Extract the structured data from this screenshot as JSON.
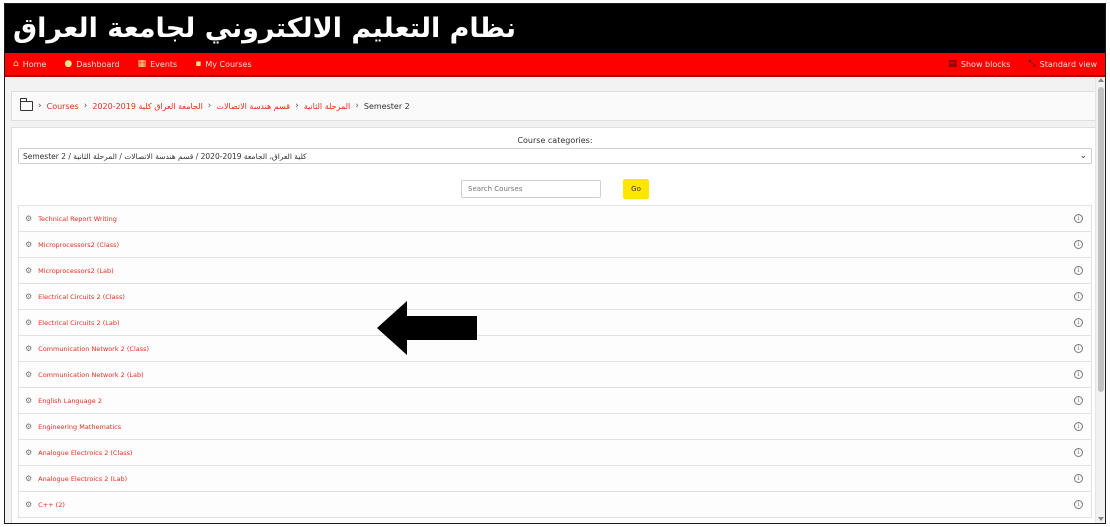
{
  "header": {
    "title": "نظام التعليم الالكتروني لجامعة العراق"
  },
  "nav": {
    "items": [
      {
        "label": "Home",
        "icon": "home-icon"
      },
      {
        "label": "Dashboard",
        "icon": "dashboard-icon"
      },
      {
        "label": "Events",
        "icon": "calendar-icon"
      },
      {
        "label": "My Courses",
        "icon": "briefcase-icon"
      }
    ],
    "right": [
      {
        "label": "Show blocks",
        "icon": "blocks-icon"
      },
      {
        "label": "Standard view",
        "icon": "expand-icon"
      }
    ]
  },
  "breadcrumb": {
    "items": [
      "Courses",
      "2020-2019 الجامعة العراق كلية",
      "قسم هندسة الاتصالات",
      "المرحلة الثانية",
      "Semester 2"
    ]
  },
  "categories": {
    "label": "Course categories:",
    "selected": "Semester 2 / كلية العراق، الجامعة 2019-2020 / قسم هندسة الاتصالات / المرحلة الثانية"
  },
  "search": {
    "placeholder": "Search Courses",
    "button": "Go"
  },
  "courses": [
    "Technical Report Writing",
    "Microprocessors2 (Class)",
    "Microprocessors2 (Lab)",
    "Electrical Circuits 2 (Class)",
    "Electrical Circuits 2 (Lab)",
    "Communication Network 2 (Class)",
    "Communication Network 2 (Lab)",
    "English Language 2",
    "Engineering Mathematics",
    "Analogue Electroics 2 (Class)",
    "Analogue Electroics 2 (Lab)",
    "C++ (2)"
  ],
  "colors": {
    "banner": "#000000",
    "navbar": "#ff0000",
    "link": "#e0301e",
    "go_button": "#ffe600"
  }
}
